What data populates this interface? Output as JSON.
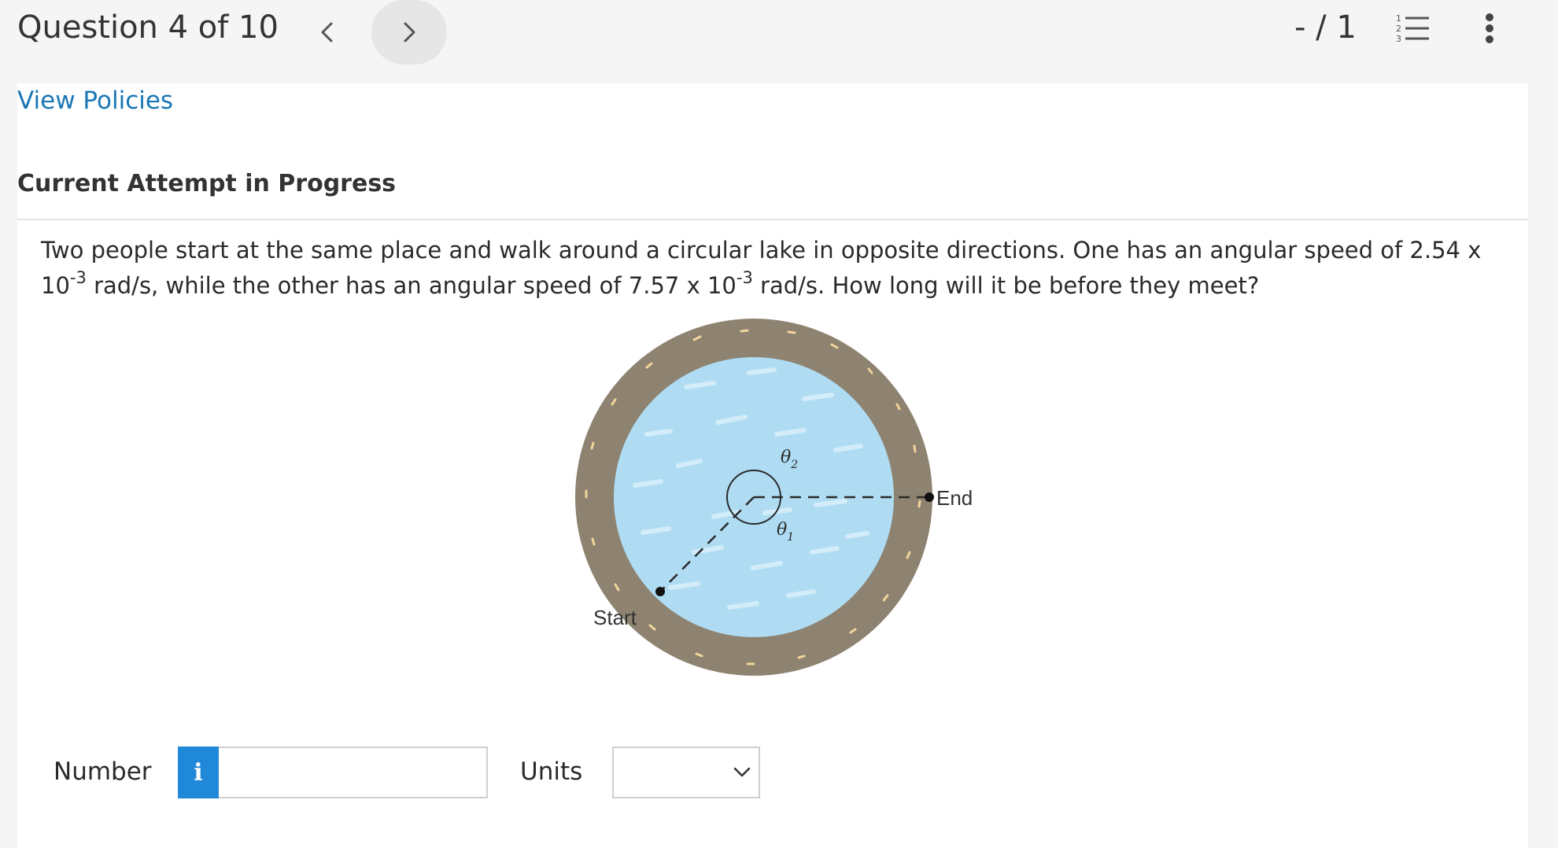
{
  "header": {
    "question_label": "Question 4 of 10",
    "score": "- / 1",
    "icons": {
      "previous": "chevron-left-icon",
      "next": "chevron-right-icon",
      "list": "numbered-list-icon",
      "more": "more-vertical-icon"
    }
  },
  "links": {
    "view_policies": "View Policies"
  },
  "attempt_heading": "Current Attempt in Progress",
  "question": {
    "part1": "Two people start at the same place and walk around a circular lake in opposite directions. One has an angular speed of 2.54 x 10",
    "exp1": "-3",
    "part2": " rad/s, while the other has an angular speed of 7.57 x 10",
    "exp2": "-3",
    "part3": " rad/s. How long will it be before they meet?"
  },
  "figure": {
    "theta2_symbol": "θ",
    "theta2_sub": "2",
    "theta1_symbol": "θ",
    "theta1_sub": "1",
    "end_label": "End",
    "start_label": "Start"
  },
  "answer": {
    "number_label": "Number",
    "info_glyph": "i",
    "number_value": "",
    "units_label": "Units",
    "units_selected": ""
  },
  "colors": {
    "link": "#1a77b5",
    "info_button": "#1f88d9",
    "path_ring": "#8e8270",
    "lake": "#afdcf3"
  }
}
